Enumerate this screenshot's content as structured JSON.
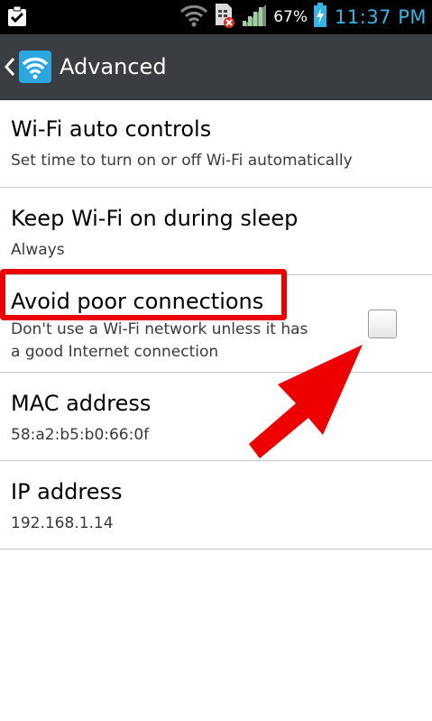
{
  "status_bar": {
    "battery_percent": "67%",
    "time": "11:37 PM",
    "icons": [
      "clipboard-check-icon",
      "wifi-signal-icon",
      "sim-no-service-icon",
      "cell-signal-icon",
      "battery-charging-icon"
    ]
  },
  "action_bar": {
    "title": "Advanced",
    "back_icon": "chevron-left-icon",
    "app_icon": "wifi-settings-icon"
  },
  "settings": [
    {
      "title": "Wi-Fi auto controls",
      "summary": "Set time to turn on or off Wi-Fi automatically"
    },
    {
      "title": "Keep Wi-Fi on during sleep",
      "summary": "Always"
    },
    {
      "title": "Avoid poor connections",
      "summary_line1": "Don't use a Wi-Fi network unless it has",
      "summary_line2": "a good Internet connection",
      "checked": false
    },
    {
      "title": "MAC address",
      "summary": "58:a2:b5:b0:66:0f"
    },
    {
      "title": "IP address",
      "summary": "192.168.1.14"
    }
  ],
  "annotation": {
    "highlight_color": "#ef0000",
    "arrow_color": "#ef0000"
  },
  "colors": {
    "clock": "#33b5e5",
    "action_bar": "#3a3d42"
  }
}
